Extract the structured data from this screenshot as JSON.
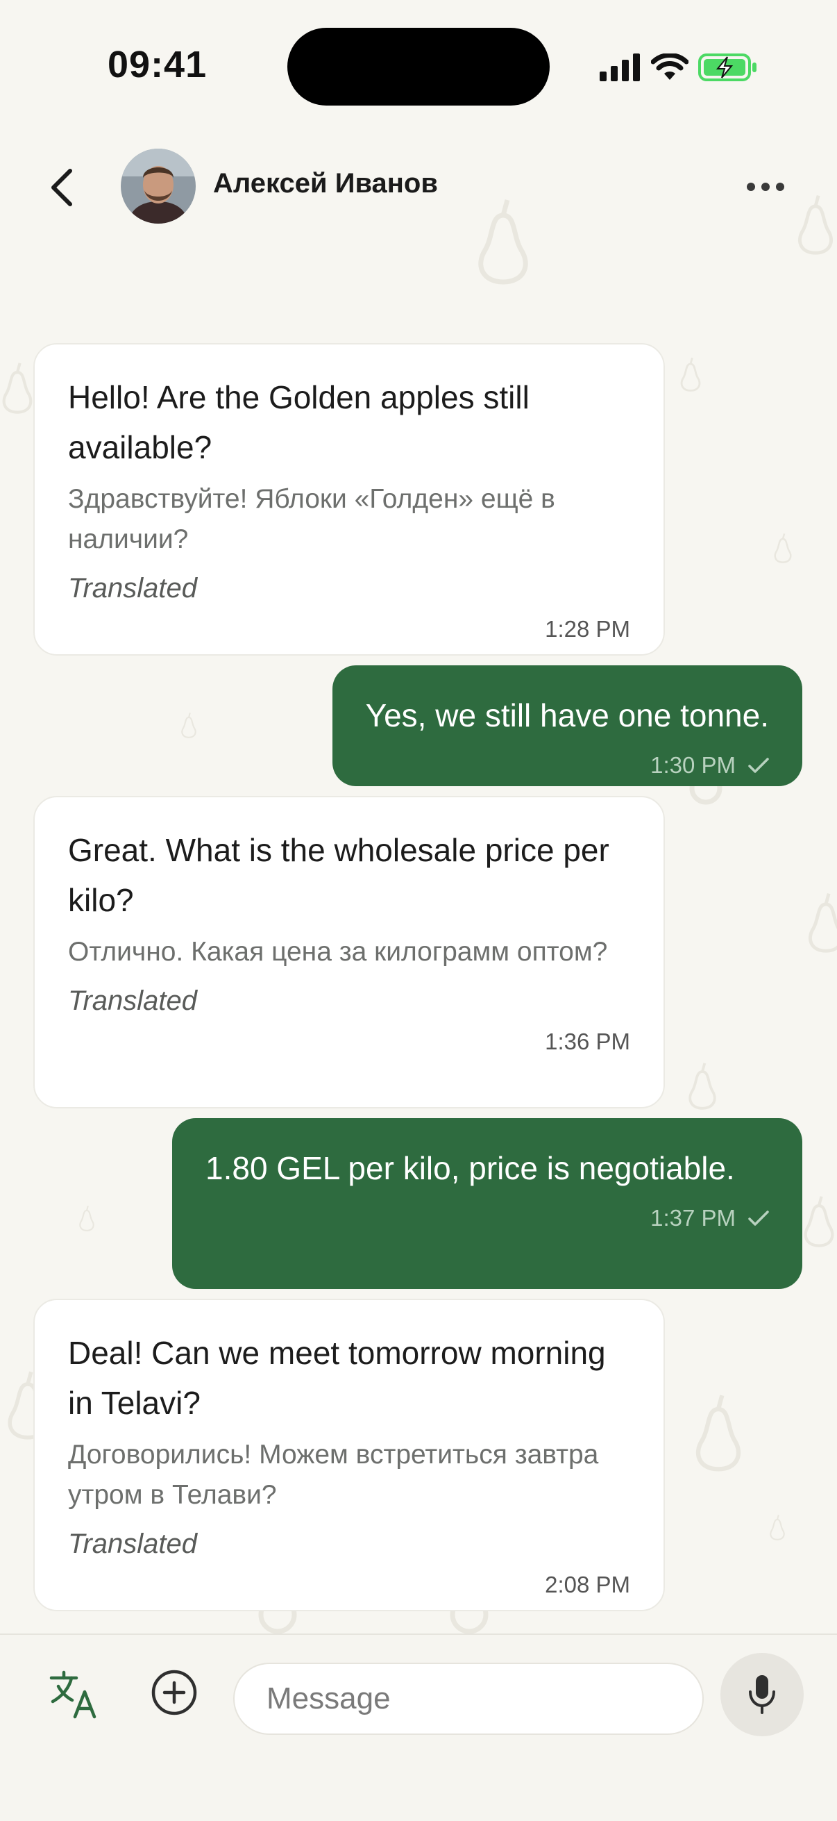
{
  "status_bar": {
    "time": "09:41"
  },
  "header": {
    "contact_name": "Алексей Иванов"
  },
  "messages": [
    {
      "direction": "incoming",
      "text": "Hello! Are the Golden apples still available?",
      "translation": "Здравствуйте! Яблоки «Голден» ещё в наличии?",
      "translated_label": "Translated",
      "time": "1:28 PM"
    },
    {
      "direction": "outgoing",
      "text": "Yes, we still have one tonne.",
      "time": "1:30 PM"
    },
    {
      "direction": "incoming",
      "text": "Great. What is the wholesale price per kilo?",
      "translation": "Отлично. Какая цена за килограмм оптом?",
      "translated_label": "Translated",
      "time": "1:36 PM"
    },
    {
      "direction": "outgoing",
      "text": "1.80 GEL per kilo, price is negotiable.",
      "time": "1:37 PM"
    },
    {
      "direction": "incoming",
      "text": "Deal! Can we meet tomorrow morning in Telavi?",
      "translation": "Договорились! Можем встретиться завтра утром в Телави?",
      "translated_label": "Translated",
      "time": "2:08 PM"
    }
  ],
  "composer": {
    "placeholder": "Message"
  },
  "colors": {
    "accent_green": "#2e6b3f",
    "background": "#f7f6f1",
    "battery_green": "#4cd964"
  }
}
